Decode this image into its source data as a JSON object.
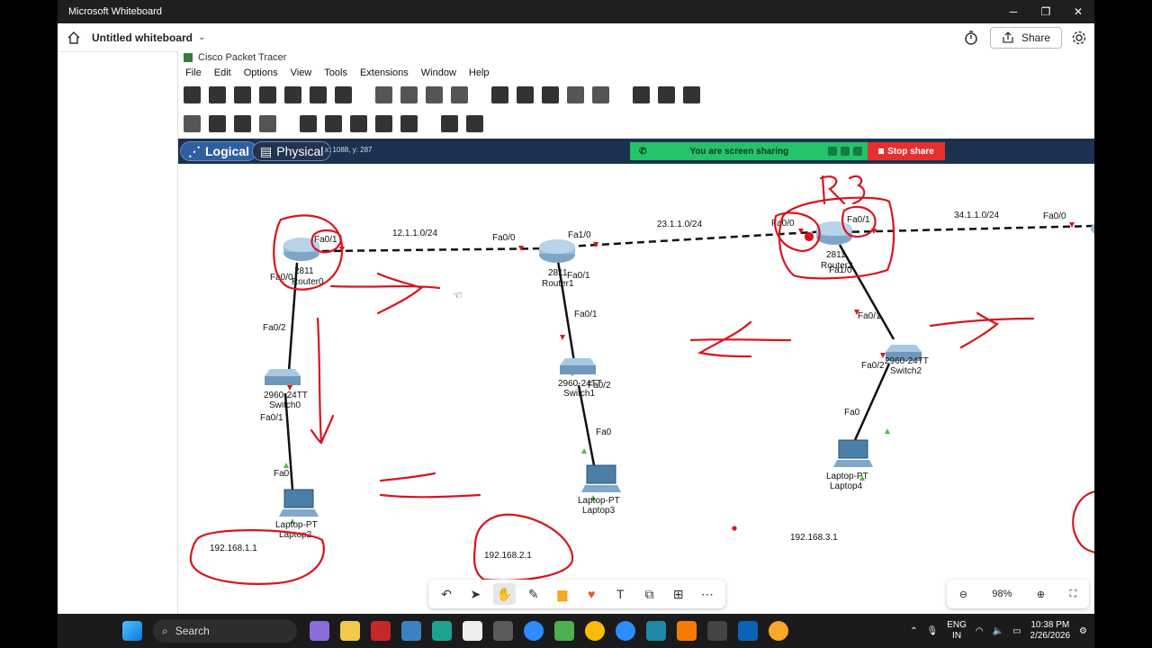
{
  "window": {
    "title": "Microsoft Whiteboard",
    "minimize": "─",
    "maximize": "❐",
    "close": "✕"
  },
  "whiteboard": {
    "title": "Untitled whiteboard",
    "share_label": "Share"
  },
  "packet_tracer": {
    "title": "Cisco Packet Tracer",
    "menu": [
      "File",
      "Edit",
      "Options",
      "View",
      "Tools",
      "Extensions",
      "Window",
      "Help"
    ],
    "mode_logical": "Logical",
    "mode_physical": "Physical",
    "coordinates": "x: 1088, y: 287",
    "screen_share_text": "You are screen sharing",
    "stop_share": "Stop share"
  },
  "topology": {
    "networks": [
      "12.1.1.0/24",
      "23.1.1.0/24",
      "34.1.1.0/24"
    ],
    "devices": {
      "router0_model": "2811",
      "router0_name": "Router0",
      "router1_model": "2811",
      "router1_name": "Router1",
      "router2_model": "2811",
      "router2_name": "Router2",
      "switch0_model": "2960-24TT",
      "switch0_name": "Switch0",
      "switch1_model": "2960-24TT",
      "switch1_name": "Switch1",
      "switch2_model": "2960-24TT",
      "switch2_name": "Switch2",
      "laptop2_model": "Laptop-PT",
      "laptop2_name": "Laptop2",
      "laptop3_model": "Laptop-PT",
      "laptop3_name": "Laptop3",
      "laptop4_model": "Laptop-PT",
      "laptop4_name": "Laptop4"
    },
    "ports": {
      "r0_fa01": "Fa0/1",
      "r0_fa00": "Fa0/0",
      "r1_fa00": "Fa0/0",
      "r1_fa10": "Fa1/0",
      "r1_fa01": "Fa0/1",
      "r2_fa00": "Fa0/0",
      "r2_fa01": "Fa0/1",
      "r2_fa10": "Fa1/0",
      "r3_fa00": "Fa0/0",
      "sw0_fa02": "Fa0/2",
      "sw0_fa01": "Fa0/1",
      "lap2_fa0": "Fa0",
      "sw1_fa01": "Fa0/1",
      "sw1_fa02": "Fa0/2",
      "lap3_fa0": "Fa0",
      "sw2_fa01": "Fa0/1",
      "sw2_fa02": "Fa0/2",
      "lap4_fa0": "Fa0"
    },
    "ip_notes": [
      "192.168.1.1",
      "192.168.2.1",
      "192.168.3.1"
    ],
    "annotation_r3": "R3"
  },
  "bottom_toolbar": {
    "zoom": "98%"
  },
  "taskbar": {
    "search": "Search",
    "lang_top": "ENG",
    "lang_bottom": "IN",
    "time": "10:38 PM",
    "date": "2/26/2026"
  },
  "colors": {
    "accent_red": "#d9141f",
    "link_black": "#111111",
    "share_green": "#23c36a",
    "stop_red": "#e63030"
  }
}
